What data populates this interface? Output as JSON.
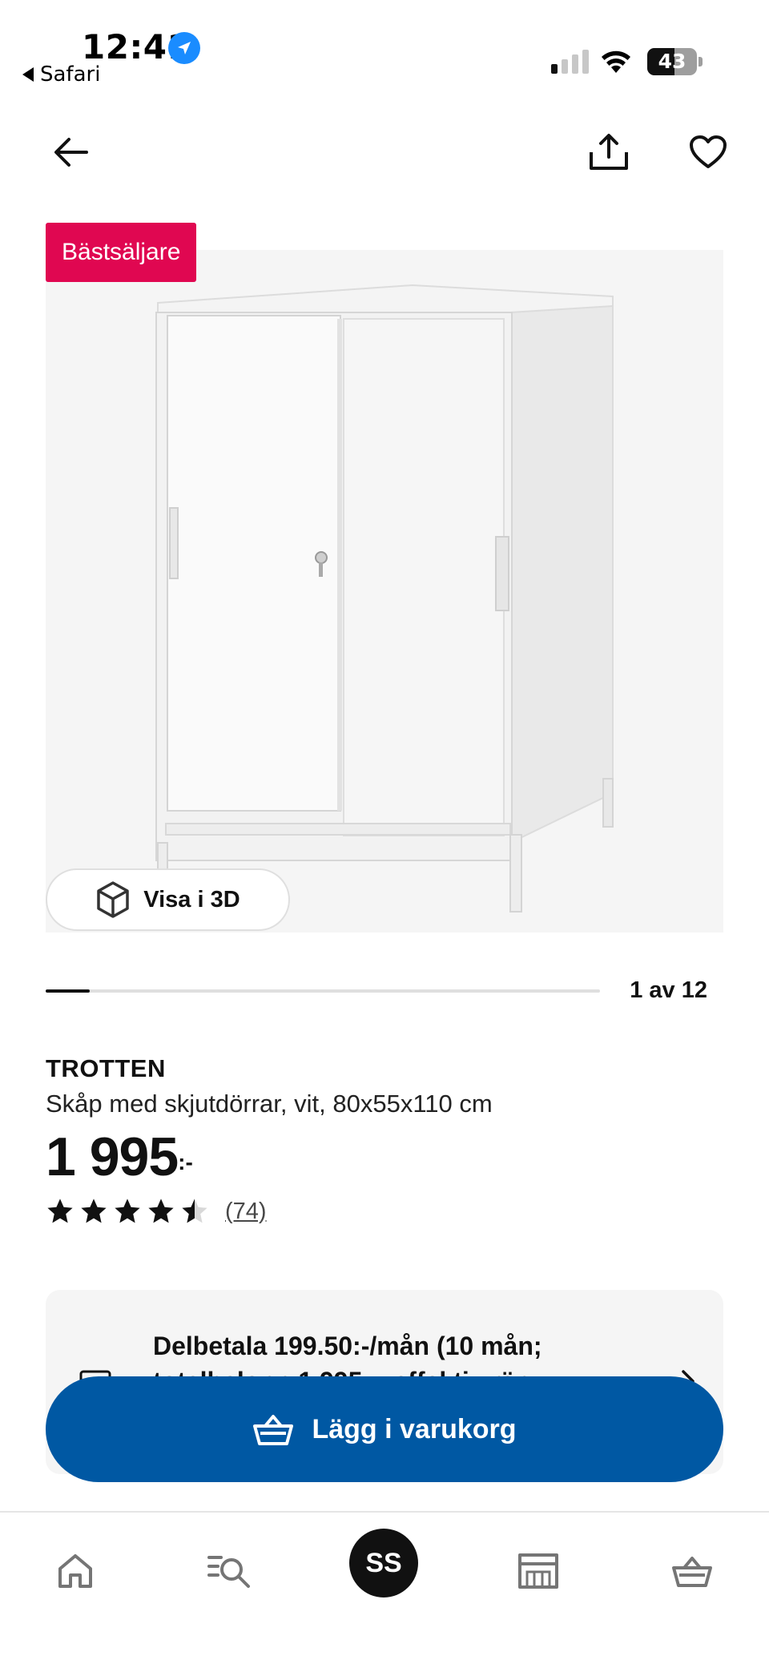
{
  "status_bar": {
    "time": "12:41",
    "back_app": "Safari",
    "battery": "43"
  },
  "nav": {
    "back_icon": "arrow-left-icon",
    "share_icon": "share-icon",
    "favorite_icon": "heart-icon"
  },
  "product_image": {
    "badge": "Bästsäljare",
    "view_3d_label": "Visa i 3D",
    "carousel_progress": 0.08,
    "page_count": "1 av 12"
  },
  "product": {
    "name": "TROTTEN",
    "description": "Skåp med skjutdörrar, vit, 80x55x110 cm",
    "price": "1 995",
    "price_suffix": ":-",
    "rating_stars": 4.5,
    "rating_count": "(74)"
  },
  "installment": {
    "line1": "Delbetala 199.50:-/mån (10 mån;",
    "line2": "totalbelopp 1 995:-, effektiv rän"
  },
  "add_to_cart": {
    "label": "Lägg i varukorg"
  },
  "tabbar": {
    "avatar_initials": "SS"
  },
  "colors": {
    "badge": "#e00751",
    "primary_button": "#0058a3",
    "location": "#1a8cff"
  }
}
